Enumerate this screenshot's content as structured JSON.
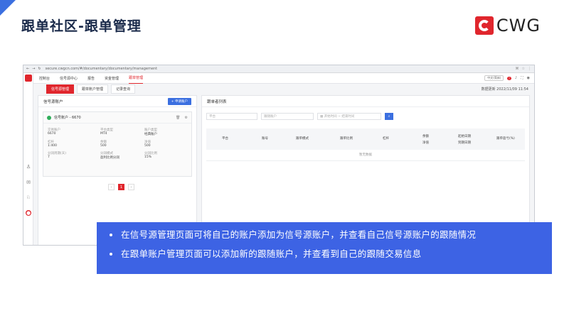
{
  "slide": {
    "title": "跟单社区-跟单管理",
    "logo_text": "CWG",
    "brand_color": "#e0262d",
    "accent_color": "#3b6fe0"
  },
  "browser": {
    "url": "secure.cwgcn.com/#/documentary/documentary/management"
  },
  "topnav": {
    "items": [
      "控制台",
      "信号源中心",
      "报告",
      "资金管理",
      "跟单管理"
    ],
    "active": "跟单管理",
    "lang": "中文(简体)"
  },
  "subtabs": {
    "items": [
      "信号源管理",
      "跟单账户管理",
      "记录查询"
    ],
    "active": "信号源管理",
    "sync_label": "数据更新  2022/11/09 11:54"
  },
  "left_panel": {
    "title": "信号源账户",
    "add_button": "+ 申请账户",
    "card": {
      "name": "信号账户 - 6670",
      "fields": [
        {
          "k": "交易账户",
          "v": "6670"
        },
        {
          "k": "平台类型",
          "v": "MT4"
        },
        {
          "k": "账户类型",
          "v": "经典账户"
        },
        {
          "k": "杠杆",
          "v": "1:400"
        },
        {
          "k": "余额",
          "v": "500"
        },
        {
          "k": "净值",
          "v": "500"
        },
        {
          "k": "分润周期(天)",
          "v": "7"
        },
        {
          "k": "分润模式",
          "v": "盈利比例分润"
        },
        {
          "k": "分润比例",
          "v": "15%"
        }
      ]
    },
    "pager": {
      "prev": "‹",
      "current": "1",
      "next": "›"
    }
  },
  "right_panel": {
    "title": "跟单者列表",
    "filters": {
      "platform": "平台",
      "account": "跟随账户",
      "start": "开始时间",
      "end": "结束时间",
      "range_sep": "~"
    },
    "columns": [
      "平台",
      "账号",
      "跟单模式",
      "跟单比例",
      "杠杆",
      "余额",
      "净值",
      "起始日期",
      "到期日期",
      "跟单盈亏(%)"
    ],
    "empty_text": "暂无数据"
  },
  "overlay": {
    "items": [
      "在信号源管理页面可将自己的账户添加为信号源账户，并查看自己信号源账户的跟随情况",
      "在跟单账户管理页面可以添加新的跟随账户，并查看到自己的跟随交易信息"
    ]
  }
}
